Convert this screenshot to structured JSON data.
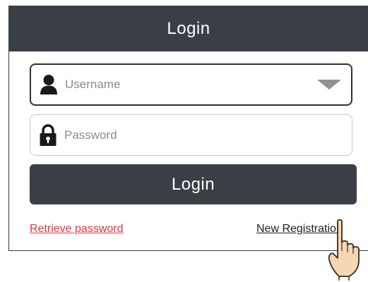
{
  "header": {
    "title": "Login"
  },
  "username_field": {
    "placeholder": "Username",
    "icon": "user-icon",
    "dropdown_icon": "dropdown-arrow-icon"
  },
  "password_field": {
    "placeholder": "Password",
    "icon": "lock-icon"
  },
  "login_button": {
    "label": "Login"
  },
  "links": {
    "retrieve_password": "Retrieve password",
    "new_registration": "New Registration"
  },
  "colors": {
    "header_bg": "#3a3f46",
    "button_bg": "#3a3f46",
    "retrieve_link": "#e8333b",
    "register_link": "#1d1d1d"
  },
  "pointer": {
    "icon": "hand-pointer-icon"
  }
}
